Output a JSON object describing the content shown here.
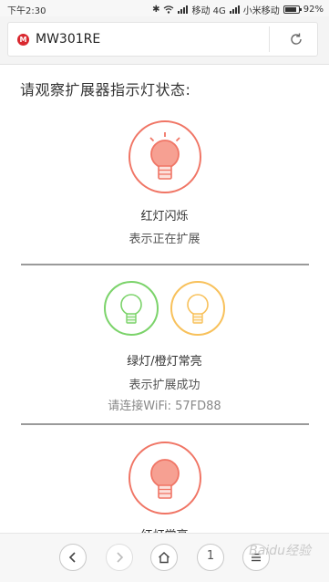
{
  "status_bar": {
    "time": "下午2:30",
    "carrier_1": "移动 4G",
    "carrier_2": "小米移动",
    "battery": "92%"
  },
  "address_bar": {
    "url": "MW301RE",
    "site_icon_letter": "M"
  },
  "content": {
    "heading": "请观察扩展器指示灯状态:",
    "sections": [
      {
        "title": "红灯闪烁",
        "desc": "表示正在扩展"
      },
      {
        "title": "绿灯/橙灯常亮",
        "desc": "表示扩展成功",
        "note": "请连接WiFi: 57FD88"
      },
      {
        "title": "红灯常亮"
      }
    ]
  },
  "nav": {
    "tabs_count": "1"
  },
  "watermark": "Baidu经验",
  "colors": {
    "red": "#f07565",
    "green": "#7bd36a",
    "orange": "#f8c15b",
    "separator": "#9a9a9a"
  }
}
